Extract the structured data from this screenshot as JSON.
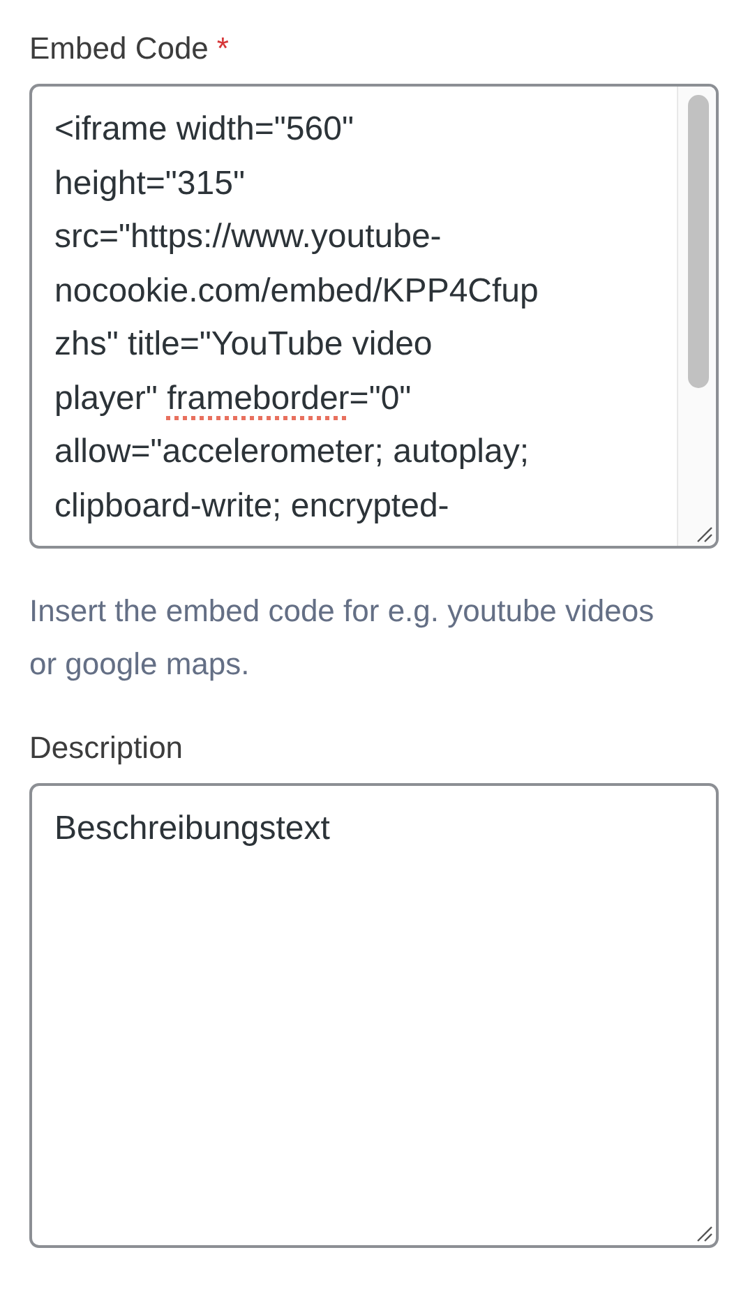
{
  "fields": [
    {
      "label": "Embed Code",
      "required": "*",
      "scrollbar": true,
      "lines": [
        {
          "segments": [
            {
              "text": "<iframe width=\"560\""
            }
          ]
        },
        {
          "segments": [
            {
              "text": "height=\"315\""
            }
          ]
        },
        {
          "segments": [
            {
              "text": "src=\"https://www.youtube-"
            }
          ]
        },
        {
          "segments": [
            {
              "text": "nocookie.com/embed/KPP4Cfup"
            }
          ]
        },
        {
          "segments": [
            {
              "text": "zhs\" title=\"YouTube video"
            }
          ]
        },
        {
          "segments": [
            {
              "text": "player\" "
            },
            {
              "text": "frameborder",
              "misspelled": true
            },
            {
              "text": "=\"0\""
            }
          ]
        },
        {
          "segments": [
            {
              "text": "allow=\"accelerometer; autoplay;"
            }
          ]
        },
        {
          "segments": [
            {
              "text": "clipboard-write; encrypted-"
            }
          ]
        }
      ],
      "help": "Insert the embed code for e.g. youtube videos or google maps."
    },
    {
      "label": "Description",
      "scrollbar": false,
      "lines": [
        {
          "segments": [
            {
              "text": "Beschreibungstext"
            }
          ]
        }
      ]
    }
  ]
}
